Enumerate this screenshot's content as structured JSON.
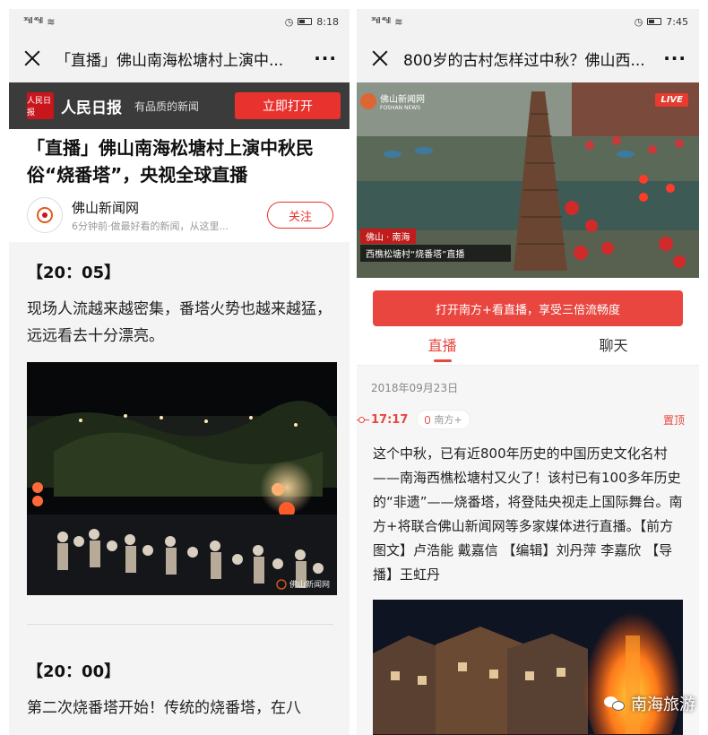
{
  "left": {
    "status": {
      "signal": "³⁶ıll ⁴⁶ıll",
      "time": "8:18"
    },
    "nav": {
      "title": "「直播」佛山南海松塘村上演中...",
      "more": "···"
    },
    "banner": {
      "logo_text": "人民日报",
      "name": "人民日报",
      "slogan": "有品质的新闻",
      "open_label": "立即打开"
    },
    "article": {
      "headline": "「直播」佛山南海松塘村上演中秋民俗“烧番塔”，央视全球直播",
      "author_name": "佛山新闻网",
      "author_desc": "6分钟前·做最好看的新闻，从这里...",
      "follow_label": "关注"
    },
    "entries": [
      {
        "time": "【20：05】",
        "text": "现场人流越来越密集，番塔火势也越来越猛，远远看去十分漂亮。"
      },
      {
        "time": "【20：00】",
        "text": "第二次烧番塔开始！传统的烧番塔，在八"
      }
    ],
    "photo_watermark": "佛山新闻网"
  },
  "right": {
    "status": {
      "signal": "³⁶ıll ⁴⁶ıll",
      "time": "7:45"
    },
    "nav": {
      "title": "800岁的古村怎样过中秋？佛山西...",
      "more": "···"
    },
    "video": {
      "logo": "佛山新闻网",
      "logo_sub": "FOSHAN NEWS",
      "live": "LIVE",
      "caption_place": "佛山 · 南海",
      "caption_title": "西樵松塘村“烧番塔”直播"
    },
    "promo_label": "打开南方+看直播，享受三倍流畅度",
    "tabs": [
      "直播",
      "聊天"
    ],
    "date": "2018年09月23日",
    "entry": {
      "time": "17:17",
      "source": "南方+",
      "pin": "置顶",
      "text": "这个中秋，已有近800年历史的中国历史文化名村——南海西樵松塘村又火了！该村已有100多年历史的“非遗”——烧番塔，将登陆央视走上国际舞台。南方+将联合佛山新闻网等多家媒体进行直播。【前方图文】卢浩能 戴嘉信 【编辑】刘丹萍 李嘉欣 【导播】王虹丹"
    }
  },
  "watermark": {
    "text": "南海旅游"
  },
  "colors": {
    "accent": "#e8322e",
    "banner": "#3b3b3b",
    "live": "#e63b2e"
  }
}
